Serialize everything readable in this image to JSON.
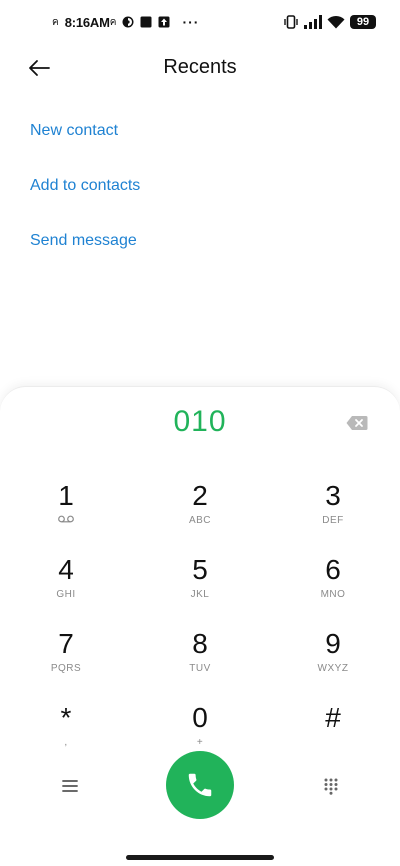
{
  "status_bar": {
    "time": "8:16AM",
    "carrier_left": "ค",
    "carrier_right": "ค",
    "more": "···",
    "battery": "99"
  },
  "header": {
    "title": "Recents",
    "back_icon": "arrow-left-icon"
  },
  "actions": [
    {
      "label": "New contact"
    },
    {
      "label": "Add to contacts"
    },
    {
      "label": "Send message"
    }
  ],
  "dialer": {
    "number": "010",
    "backspace_icon": "backspace-icon",
    "keys": [
      {
        "digit": "1",
        "sub": ""
      },
      {
        "digit": "2",
        "sub": "ABC"
      },
      {
        "digit": "3",
        "sub": "DEF"
      },
      {
        "digit": "4",
        "sub": "GHI"
      },
      {
        "digit": "5",
        "sub": "JKL"
      },
      {
        "digit": "6",
        "sub": "MNO"
      },
      {
        "digit": "7",
        "sub": "PQRS"
      },
      {
        "digit": "8",
        "sub": "TUV"
      },
      {
        "digit": "9",
        "sub": "WXYZ"
      },
      {
        "digit": "*",
        "sub": ","
      },
      {
        "digit": "0",
        "sub": "+"
      },
      {
        "digit": "#",
        "sub": ""
      }
    ]
  },
  "bottom_bar": {
    "menu_icon": "hamburger-menu-icon",
    "call_icon": "phone-icon",
    "keypad_icon": "dialpad-icon"
  },
  "colors": {
    "accent_blue": "#1f82d2",
    "call_green": "#21b35a"
  }
}
